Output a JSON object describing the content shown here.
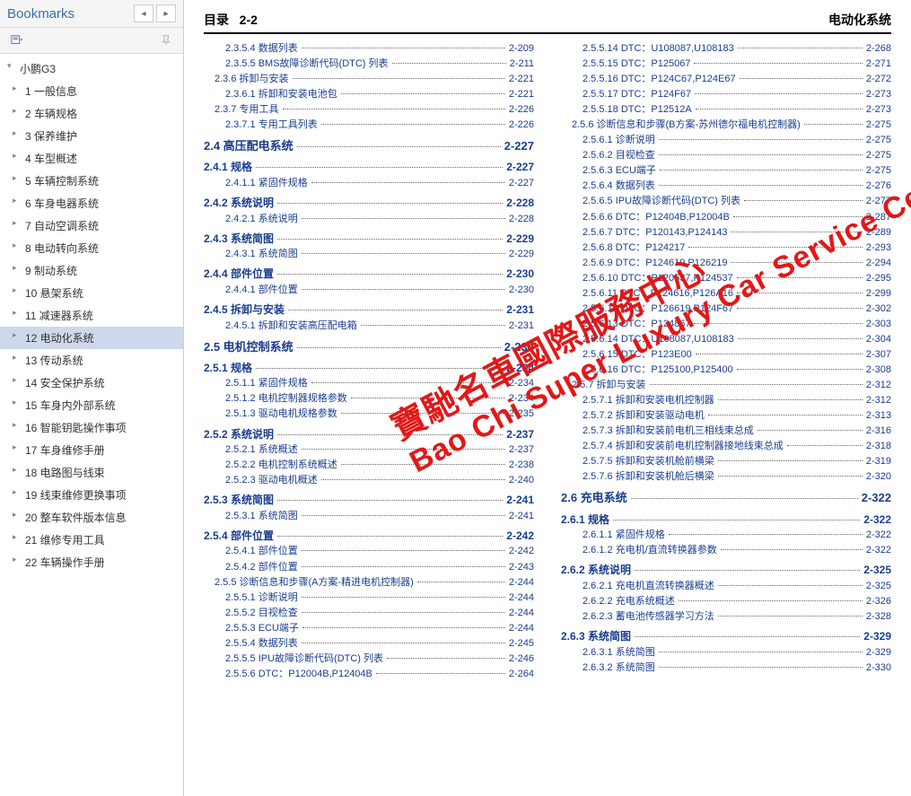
{
  "sidebar": {
    "title": "Bookmarks",
    "items": [
      {
        "label": "小鹏G3",
        "root": true
      },
      {
        "label": "1 一般信息"
      },
      {
        "label": "2 车辆规格"
      },
      {
        "label": "3 保养维护"
      },
      {
        "label": "4 车型概述"
      },
      {
        "label": "5 车辆控制系统"
      },
      {
        "label": "6 车身电器系统"
      },
      {
        "label": "7 自动空调系统"
      },
      {
        "label": "8 电动转向系统"
      },
      {
        "label": "9 制动系统"
      },
      {
        "label": "10 悬架系统"
      },
      {
        "label": "11 减速器系统"
      },
      {
        "label": "12 电动化系统",
        "selected": true
      },
      {
        "label": "13 传动系统"
      },
      {
        "label": "14 安全保护系统"
      },
      {
        "label": "15 车身内外部系统"
      },
      {
        "label": "16 智能钥匙操作事项"
      },
      {
        "label": "17 车身维修手册"
      },
      {
        "label": "18 电路图与线束"
      },
      {
        "label": "19 线束维修更换事项"
      },
      {
        "label": "20 整车软件版本信息"
      },
      {
        "label": "21 维修专用工具"
      },
      {
        "label": "22 车辆操作手册"
      }
    ]
  },
  "page": {
    "toc_label": "目录",
    "page_num": "2-2",
    "section_title": "电动化系统"
  },
  "watermark": {
    "cn": "寶馳名車國際服務中心",
    "en": "Bao Chi Super Luxury Car Service Center"
  },
  "colA": [
    {
      "lvl": 4,
      "t": "2.3.5.4 数据列表",
      "p": "2-209"
    },
    {
      "lvl": 4,
      "t": "2.3.5.5 BMS故障诊断代码(DTC) 列表",
      "p": "2-211"
    },
    {
      "lvl": 3,
      "t": "2.3.6 拆卸与安装",
      "p": "2-221"
    },
    {
      "lvl": 4,
      "t": "2.3.6.1 拆卸和安装电池包",
      "p": "2-221"
    },
    {
      "lvl": 3,
      "t": "2.3.7 专用工具",
      "p": "2-226"
    },
    {
      "lvl": 4,
      "t": "2.3.7.1 专用工具列表",
      "p": "2-226"
    },
    {
      "lvl": 1,
      "t": "2.4 高压配电系统",
      "p": "2-227"
    },
    {
      "lvl": 2,
      "t": "2.4.1 规格",
      "p": "2-227"
    },
    {
      "lvl": 4,
      "t": "2.4.1.1 紧固件规格",
      "p": "2-227"
    },
    {
      "lvl": 2,
      "t": "2.4.2 系统说明",
      "p": "2-228"
    },
    {
      "lvl": 4,
      "t": "2.4.2.1 系统说明",
      "p": "2-228"
    },
    {
      "lvl": 2,
      "t": "2.4.3 系统简图",
      "p": "2-229"
    },
    {
      "lvl": 4,
      "t": "2.4.3.1 系统简图",
      "p": "2-229"
    },
    {
      "lvl": 2,
      "t": "2.4.4 部件位置",
      "p": "2-230"
    },
    {
      "lvl": 4,
      "t": "2.4.4.1 部件位置",
      "p": "2-230"
    },
    {
      "lvl": 2,
      "t": "2.4.5 拆卸与安装",
      "p": "2-231"
    },
    {
      "lvl": 4,
      "t": "2.4.5.1 拆卸和安装高压配电箱",
      "p": "2-231"
    },
    {
      "lvl": 1,
      "t": "2.5 电机控制系统",
      "p": "2-234"
    },
    {
      "lvl": 2,
      "t": "2.5.1 规格",
      "p": "2-234"
    },
    {
      "lvl": 4,
      "t": "2.5.1.1 紧固件规格",
      "p": "2-234"
    },
    {
      "lvl": 4,
      "t": "2.5.1.2 电机控制器规格参数",
      "p": "2-234"
    },
    {
      "lvl": 4,
      "t": "2.5.1.3 驱动电机规格参数",
      "p": "2-235"
    },
    {
      "lvl": 2,
      "t": "2.5.2 系统说明",
      "p": "2-237"
    },
    {
      "lvl": 4,
      "t": "2.5.2.1 系统概述",
      "p": "2-237"
    },
    {
      "lvl": 4,
      "t": "2.5.2.2 电机控制系统概述",
      "p": "2-238"
    },
    {
      "lvl": 4,
      "t": "2.5.2.3 驱动电机概述",
      "p": "2-240"
    },
    {
      "lvl": 2,
      "t": "2.5.3 系统简图",
      "p": "2-241"
    },
    {
      "lvl": 4,
      "t": "2.5.3.1 系统简图",
      "p": "2-241"
    },
    {
      "lvl": 2,
      "t": "2.5.4 部件位置",
      "p": "2-242"
    },
    {
      "lvl": 4,
      "t": "2.5.4.1 部件位置",
      "p": "2-242"
    },
    {
      "lvl": 4,
      "t": "2.5.4.2 部件位置",
      "p": "2-243"
    },
    {
      "lvl": 3,
      "t": "2.5.5 诊断信息和步骤(A方案-精进电机控制器)",
      "p": "2-244",
      "wrap": true
    },
    {
      "lvl": 4,
      "t": "2.5.5.1 诊断说明",
      "p": "2-244"
    },
    {
      "lvl": 4,
      "t": "2.5.5.2 目视检查",
      "p": "2-244"
    },
    {
      "lvl": 4,
      "t": "2.5.5.3 ECU端子",
      "p": "2-244"
    },
    {
      "lvl": 4,
      "t": "2.5.5.4 数据列表",
      "p": "2-245"
    },
    {
      "lvl": 4,
      "t": "2.5.5.5 IPU故障诊断代码(DTC) 列表",
      "p": "2-246"
    },
    {
      "lvl": 4,
      "t": "2.5.5.6 DTC：P12004B,P12404B",
      "p": "2-264"
    }
  ],
  "colB": [
    {
      "lvl": 4,
      "t": "2.5.5.14 DTC：U108087,U108183",
      "p": "2-268"
    },
    {
      "lvl": 4,
      "t": "2.5.5.15 DTC：P125067",
      "p": "2-271"
    },
    {
      "lvl": 4,
      "t": "2.5.5.16 DTC：P124C67,P124E67",
      "p": "2-272"
    },
    {
      "lvl": 4,
      "t": "2.5.5.17 DTC：P124F67",
      "p": "2-273"
    },
    {
      "lvl": 4,
      "t": "2.5.5.18 DTC：P12512A",
      "p": "2-273"
    },
    {
      "lvl": 3,
      "t": "2.5.6 诊断信息和步骤(B方案-苏州德尔福电机控制器)",
      "p": "2-275",
      "wrap": true
    },
    {
      "lvl": 4,
      "t": "2.5.6.1 诊断说明",
      "p": "2-275"
    },
    {
      "lvl": 4,
      "t": "2.5.6.2 目视检查",
      "p": "2-275"
    },
    {
      "lvl": 4,
      "t": "2.5.6.3 ECU端子",
      "p": "2-275"
    },
    {
      "lvl": 4,
      "t": "2.5.6.4 数据列表",
      "p": "2-276"
    },
    {
      "lvl": 4,
      "t": "2.5.6.5 IPU故障诊断代码(DTC) 列表",
      "p": "2-277"
    },
    {
      "lvl": 4,
      "t": "2.5.6.6 DTC：P12404B,P12004B",
      "p": "2-287"
    },
    {
      "lvl": 4,
      "t": "2.5.6.7 DTC：P120143,P124143",
      "p": "2-289"
    },
    {
      "lvl": 4,
      "t": "2.5.6.8 DTC：P124217",
      "p": "2-293"
    },
    {
      "lvl": 4,
      "t": "2.5.6.9 DTC：P124619,P126219",
      "p": "2-294"
    },
    {
      "lvl": 4,
      "t": "2.5.6.10 DTC：P120537,P124537",
      "p": "2-295"
    },
    {
      "lvl": 4,
      "t": "2.5.6.11 DTC：P124616,P126A16",
      "p": "2-299"
    },
    {
      "lvl": 4,
      "t": "2.5.6.12 DTC：P126619,P124F67",
      "p": "2-302"
    },
    {
      "lvl": 4,
      "t": "2.5.6.13 DTC：P124867",
      "p": "2-303"
    },
    {
      "lvl": 4,
      "t": "2.5.6.14 DTC：U108087,U108183",
      "p": "2-304"
    },
    {
      "lvl": 4,
      "t": "2.5.6.15 DTC：P123E00",
      "p": "2-307"
    },
    {
      "lvl": 4,
      "t": "2.5.6.16 DTC：P125100,P125400",
      "p": "2-308"
    },
    {
      "lvl": 3,
      "t": "2.5.7 拆卸与安装",
      "p": "2-312"
    },
    {
      "lvl": 4,
      "t": "2.5.7.1 拆卸和安装电机控制器",
      "p": "2-312"
    },
    {
      "lvl": 4,
      "t": "2.5.7.2 拆卸和安装驱动电机",
      "p": "2-313"
    },
    {
      "lvl": 4,
      "t": "2.5.7.3 拆卸和安装前电机三相线束总成",
      "p": "2-316"
    },
    {
      "lvl": 4,
      "t": "2.5.7.4 拆卸和安装前电机控制器接地线束总成",
      "p": "2-318",
      "wrap": true
    },
    {
      "lvl": 4,
      "t": "2.5.7.5 拆卸和安装机舱前横梁",
      "p": "2-319"
    },
    {
      "lvl": 4,
      "t": "2.5.7.6 拆卸和安装机舱后横梁",
      "p": "2-320"
    },
    {
      "lvl": 1,
      "t": "2.6 充电系统",
      "p": "2-322"
    },
    {
      "lvl": 2,
      "t": "2.6.1 规格",
      "p": "2-322"
    },
    {
      "lvl": 4,
      "t": "2.6.1.1 紧固件规格",
      "p": "2-322"
    },
    {
      "lvl": 4,
      "t": "2.6.1.2 充电机/直流转换器参数",
      "p": "2-322"
    },
    {
      "lvl": 2,
      "t": "2.6.2 系统说明",
      "p": "2-325"
    },
    {
      "lvl": 4,
      "t": "2.6.2.1 充电机直流转换器概述",
      "p": "2-325"
    },
    {
      "lvl": 4,
      "t": "2.6.2.2 充电系统概述",
      "p": "2-326"
    },
    {
      "lvl": 4,
      "t": "2.6.2.3 蓄电池传感器学习方法",
      "p": "2-328"
    },
    {
      "lvl": 2,
      "t": "2.6.3 系统简图",
      "p": "2-329"
    },
    {
      "lvl": 4,
      "t": "2.6.3.1 系统简图",
      "p": "2-329"
    },
    {
      "lvl": 4,
      "t": "2.6.3.2 系统简图",
      "p": "2-330"
    }
  ]
}
